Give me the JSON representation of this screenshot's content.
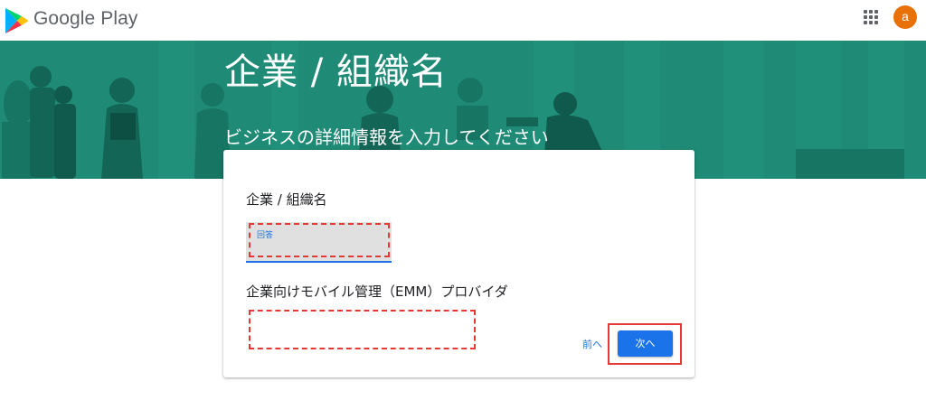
{
  "header": {
    "brand": "Google Play",
    "apps_icon": "apps-grid-icon",
    "avatar_letter": "a"
  },
  "banner": {
    "title": "企業 / 組織名",
    "subtitle": "ビジネスの詳細情報を入力してください"
  },
  "form": {
    "field1_label": "企業 / 組織名",
    "field1_placeholder": "回答",
    "field2_label": "企業向けモバイル管理（EMM）プロバイダ",
    "back_label": "前へ",
    "next_label": "次へ"
  },
  "colors": {
    "banner": "#1f8a75",
    "accent": "#1a73e8",
    "avatar": "#e8710a",
    "highlight": "#e53935"
  }
}
